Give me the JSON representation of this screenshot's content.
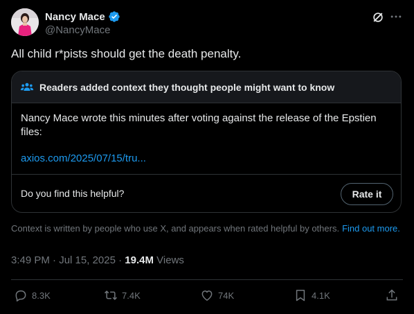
{
  "author": {
    "name": "Nancy Mace",
    "handle": "@NancyMace",
    "verified": true,
    "avatar_icon": "profile-photo"
  },
  "tweet": {
    "text": "All child r*pists should get the death penalty."
  },
  "community_note": {
    "header": "Readers added context they thought people might want to know",
    "body": "Nancy Mace wrote this minutes after voting against the release of the Epstien files:",
    "link": "axios.com/2025/07/15/tru...",
    "helpful_question": "Do you find this helpful?",
    "rate_button": "Rate it"
  },
  "context_disclaimer": {
    "text": "Context is written by people who use X, and appears when rated helpful by others.",
    "link": "Find out more."
  },
  "meta": {
    "time": "3:49 PM",
    "separator": "·",
    "date": "Jul 15, 2025",
    "separator2": "·",
    "views_count": "19.4M",
    "views_label": "Views"
  },
  "actions": {
    "replies": "8.3K",
    "reposts": "7.4K",
    "likes": "74K",
    "bookmarks": "4.1K"
  },
  "colors": {
    "background": "#000000",
    "text": "#e7e9ea",
    "secondary": "#71767b",
    "accent": "#1d9bf0",
    "border": "#2f3336"
  }
}
